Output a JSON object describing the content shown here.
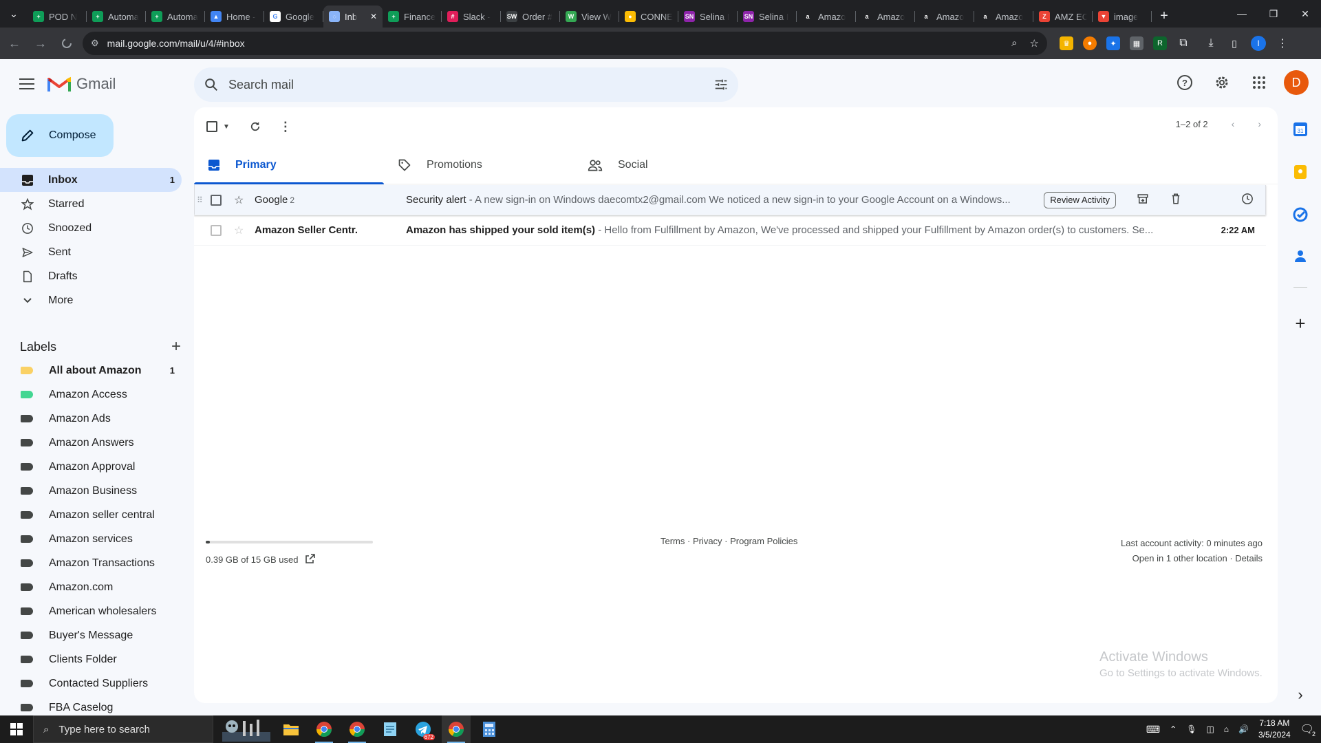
{
  "browser": {
    "tabs": [
      {
        "title": "POD N",
        "fav_color": "#0f9d58",
        "fav_glyph": "+"
      },
      {
        "title": "Automa",
        "fav_color": "#0f9d58",
        "fav_glyph": "+"
      },
      {
        "title": "Automa",
        "fav_color": "#0f9d58",
        "fav_glyph": "+"
      },
      {
        "title": "Home -",
        "fav_color": "#4285f4",
        "fav_glyph": "▲"
      },
      {
        "title": "Google",
        "fav_color": "#ffffff",
        "fav_glyph": "G"
      },
      {
        "title": "Inb",
        "fav_color": "#8ab4f8",
        "fav_glyph": "◌",
        "active": true
      },
      {
        "title": "Finance",
        "fav_color": "#0f9d58",
        "fav_glyph": "+"
      },
      {
        "title": "Slack -",
        "fav_color": "#e01e5a",
        "fav_glyph": "#"
      },
      {
        "title": "Order #",
        "fav_color": "#3c4043",
        "fav_glyph": "SW"
      },
      {
        "title": "View W",
        "fav_color": "#34a853",
        "fav_glyph": "W"
      },
      {
        "title": "CONNE",
        "fav_color": "#fbbc04",
        "fav_glyph": "●"
      },
      {
        "title": "Selina I",
        "fav_color": "#8e24aa",
        "fav_glyph": "SN"
      },
      {
        "title": "Selina I",
        "fav_color": "#8e24aa",
        "fav_glyph": "SN"
      },
      {
        "title": "Amazo",
        "fav_color": "#202124",
        "fav_glyph": "a"
      },
      {
        "title": "Amazo",
        "fav_color": "#202124",
        "fav_glyph": "a"
      },
      {
        "title": "Amazo",
        "fav_color": "#202124",
        "fav_glyph": "a"
      },
      {
        "title": "Amazo",
        "fav_color": "#202124",
        "fav_glyph": "a"
      },
      {
        "title": "AMZ EC",
        "fav_color": "#ea4335",
        "fav_glyph": "Z"
      },
      {
        "title": "image",
        "fav_color": "#ea4335",
        "fav_glyph": "▼"
      }
    ],
    "url": "mail.google.com/mail/u/4/#inbox",
    "profile_initial": "I"
  },
  "gmail": {
    "logo_text": "Gmail",
    "search_placeholder": "Search mail",
    "avatar_initial": "D",
    "compose_label": "Compose",
    "nav": [
      {
        "label": "Inbox",
        "count": "1",
        "icon": "inbox-icon",
        "active": true
      },
      {
        "label": "Starred",
        "count": "",
        "icon": "star-icon"
      },
      {
        "label": "Snoozed",
        "count": "",
        "icon": "clock-icon"
      },
      {
        "label": "Sent",
        "count": "",
        "icon": "send-icon"
      },
      {
        "label": "Drafts",
        "count": "",
        "icon": "draft-icon"
      },
      {
        "label": "More",
        "count": "",
        "icon": "chevron-down-icon"
      }
    ],
    "labels_title": "Labels",
    "labels": [
      {
        "label": "All about Amazon",
        "count": "1",
        "color": "#fad165",
        "bold": true
      },
      {
        "label": "Amazon Access",
        "count": "",
        "color": "#43d692"
      },
      {
        "label": "Amazon Ads",
        "count": "",
        "color": "#444746"
      },
      {
        "label": "Amazon Answers",
        "count": "",
        "color": "#444746"
      },
      {
        "label": "Amazon Approval",
        "count": "",
        "color": "#444746"
      },
      {
        "label": "Amazon Business",
        "count": "",
        "color": "#444746"
      },
      {
        "label": "Amazon seller central",
        "count": "",
        "color": "#444746"
      },
      {
        "label": "Amazon services",
        "count": "",
        "color": "#444746"
      },
      {
        "label": "Amazon Transactions",
        "count": "",
        "color": "#444746"
      },
      {
        "label": "Amazon.com",
        "count": "",
        "color": "#444746"
      },
      {
        "label": "American wholesalers",
        "count": "",
        "color": "#444746"
      },
      {
        "label": "Buyer's Message",
        "count": "",
        "color": "#444746"
      },
      {
        "label": "Clients Folder",
        "count": "",
        "color": "#444746"
      },
      {
        "label": "Contacted Suppliers",
        "count": "",
        "color": "#444746"
      },
      {
        "label": "FBA Caselog",
        "count": "",
        "color": "#444746"
      }
    ],
    "pager_text": "1–2 of 2",
    "tabs": [
      {
        "label": "Primary",
        "icon": "inbox-icon",
        "active": true
      },
      {
        "label": "Promotions",
        "icon": "tag-icon"
      },
      {
        "label": "Social",
        "icon": "people-icon"
      }
    ],
    "emails": [
      {
        "sender": "Google",
        "thread_count": "2",
        "subject": "Security alert",
        "snippet": " - A new sign-in on Windows daecomtx2@gmail.com We noticed a new sign-in to your Google Account on a Windows...",
        "action_chip": "Review Activity",
        "time": "",
        "unread": false
      },
      {
        "sender": "Amazon Seller Centr.",
        "thread_count": "",
        "subject": "Amazon has shipped your sold item(s)",
        "snippet": " - Hello from Fulfillment by Amazon, We've processed and shipped your Fulfillment by Amazon order(s) to customers. Se...",
        "action_chip": "",
        "time": "2:22 AM",
        "unread": true
      }
    ],
    "footer": {
      "storage_text": "0.39 GB of 15 GB used",
      "storage_fraction": 0.026,
      "policies": "Terms · Privacy · Program Policies",
      "activity_line1": "Last account activity: 0 minutes ago",
      "activity_line2": "Open in 1 other location · Details"
    }
  },
  "watermark": {
    "line1": "Activate Windows",
    "line2": "Go to Settings to activate Windows."
  },
  "taskbar": {
    "search_placeholder": "Type here to search",
    "time": "7:18 AM",
    "date": "3/5/2024",
    "notif_count": "2",
    "telegram_badge": "672"
  }
}
